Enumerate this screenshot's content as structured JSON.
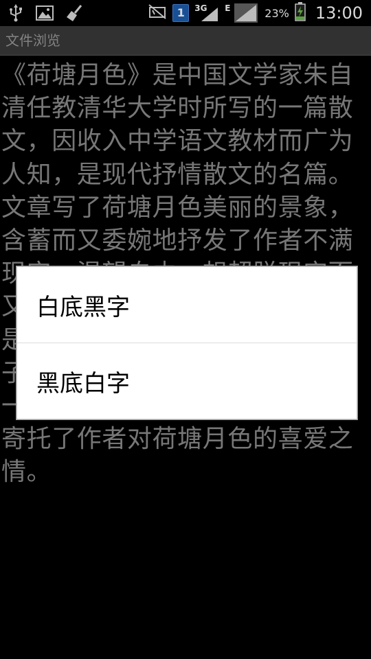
{
  "status_bar": {
    "icons_left": [
      "usb-icon",
      "image-icon",
      "broom-icon"
    ],
    "icons_right": [
      "mute-icon",
      "sim-icon",
      "signal-3g-icon",
      "signal-e-icon",
      "battery-icon"
    ],
    "sim_label": "1",
    "net_3g": "3G",
    "net_e": "E",
    "battery_percent": "23%",
    "time": "13:00"
  },
  "title_bar": {
    "title": "文件浏览"
  },
  "content": {
    "text": "《荷塘月色》是中国文学家朱自清任教清华大学时所写的一篇散文，因收入中学语文教材而广为人知，是现代抒情散文的名篇。文章写了荷塘月色美丽的景象，含蓄而又委婉地抒发了作者不满现实、渴望自由，想超脱现实而又不能的复杂心情，这种心情正是那个黑暗的旧中国正直知识分子心境的写照。文章寄托了作者一种向往于未来的政治思想，也寄托了作者对荷塘月色的喜爱之情。"
  },
  "dialog": {
    "options": [
      {
        "label": "白底黑字"
      },
      {
        "label": "黑底白字"
      }
    ]
  },
  "colors": {
    "background": "#000000",
    "title_bar": "#3a3a3a",
    "title_text": "#9a9a9a",
    "body_text": "#8c8c8c",
    "dialog_bg": "#ffffff",
    "dialog_text": "#000000",
    "sim_badge": "#1e5fb0",
    "battery_fill": "#6cc04a"
  }
}
